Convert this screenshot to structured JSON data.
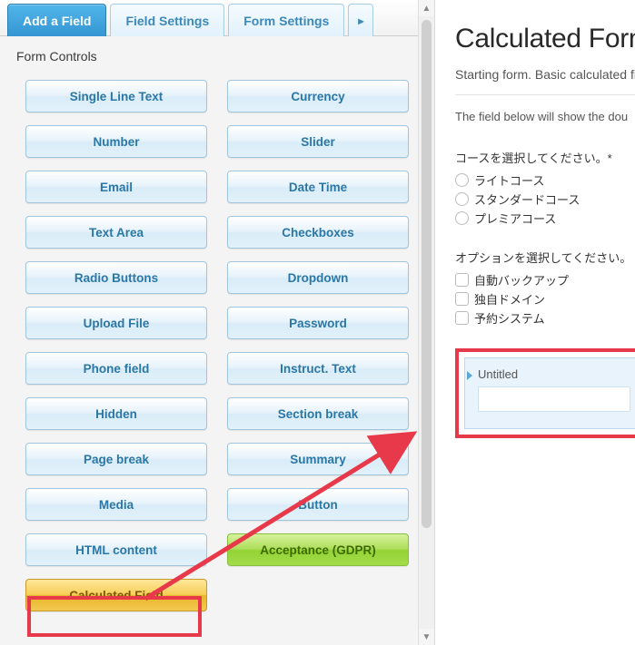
{
  "tabs": {
    "add_field": "Add a Field",
    "field_settings": "Field Settings",
    "form_settings": "Form Settings"
  },
  "section_title": "Form Controls",
  "fields": {
    "single_line_text": "Single Line Text",
    "currency": "Currency",
    "number": "Number",
    "slider": "Slider",
    "email": "Email",
    "date_time": "Date Time",
    "text_area": "Text Area",
    "checkboxes": "Checkboxes",
    "radio_buttons": "Radio Buttons",
    "dropdown": "Dropdown",
    "upload_file": "Upload File",
    "password": "Password",
    "phone_field": "Phone field",
    "instruct_text": "Instruct. Text",
    "hidden": "Hidden",
    "section_break": "Section break",
    "page_break": "Page break",
    "summary": "Summary",
    "media": "Media",
    "button": "Button",
    "html_content": "HTML content",
    "acceptance_gdpr": "Acceptance (GDPR)",
    "calculated_field": "Calculated Field"
  },
  "preview": {
    "title": "Calculated Form",
    "subtitle": "Starting form. Basic calculated fi",
    "helper": "The field below will show the dou",
    "course_label": "コースを選択してください。*",
    "course_options": {
      "light": "ライトコース",
      "standard": "スタンダードコース",
      "premier": "プレミアコース"
    },
    "option_label": "オプションを選択してください。",
    "option_items": {
      "backup": "自動バックアップ",
      "domain": "独自ドメイン",
      "reservation": "予約システム"
    },
    "untitled_label": "Untitled"
  }
}
